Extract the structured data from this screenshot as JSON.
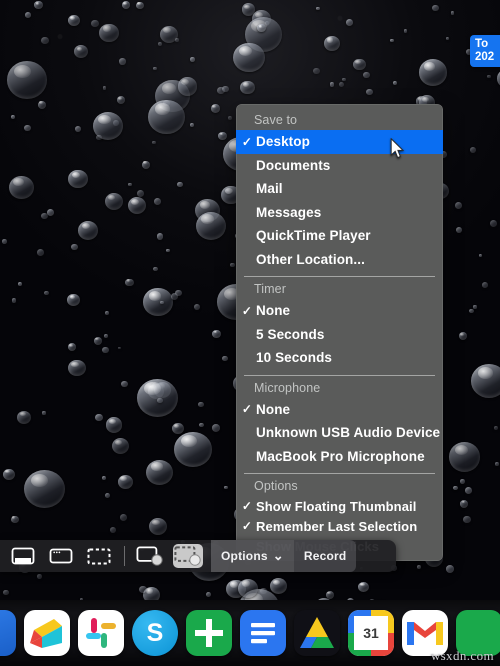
{
  "menu": {
    "sections": [
      {
        "title": "Save to",
        "items": [
          {
            "label": "Desktop",
            "checked": true,
            "highlighted": true
          },
          {
            "label": "Documents",
            "checked": false,
            "highlighted": false
          },
          {
            "label": "Mail",
            "checked": false,
            "highlighted": false
          },
          {
            "label": "Messages",
            "checked": false,
            "highlighted": false
          },
          {
            "label": "QuickTime Player",
            "checked": false,
            "highlighted": false
          },
          {
            "label": "Other Location...",
            "checked": false,
            "highlighted": false
          }
        ]
      },
      {
        "title": "Timer",
        "items": [
          {
            "label": "None",
            "checked": true,
            "highlighted": false
          },
          {
            "label": "5 Seconds",
            "checked": false,
            "highlighted": false
          },
          {
            "label": "10 Seconds",
            "checked": false,
            "highlighted": false
          }
        ]
      },
      {
        "title": "Microphone",
        "items": [
          {
            "label": "None",
            "checked": true,
            "highlighted": false
          },
          {
            "label": "Unknown USB Audio Device",
            "checked": false,
            "highlighted": false
          },
          {
            "label": "MacBook Pro Microphone",
            "checked": false,
            "highlighted": false
          }
        ]
      },
      {
        "title": "Options",
        "items": [
          {
            "label": "Show Floating Thumbnail",
            "checked": true,
            "highlighted": false
          },
          {
            "label": "Remember Last Selection",
            "checked": true,
            "highlighted": false
          },
          {
            "label": "Show Mouse Clicks",
            "checked": false,
            "highlighted": false
          }
        ]
      }
    ],
    "check_glyph": "✓",
    "highlight_color": "#0a6ef2",
    "background_color": "#5a5b5a"
  },
  "toolbar": {
    "capture_tools": [
      {
        "name": "capture-entire-screen",
        "selected": false
      },
      {
        "name": "capture-selected-window",
        "selected": false
      },
      {
        "name": "capture-selected-portion",
        "selected": false
      }
    ],
    "record_tools": [
      {
        "name": "record-entire-screen",
        "selected": false
      },
      {
        "name": "record-selected-portion",
        "selected": true
      }
    ],
    "options_label": "Options",
    "options_chevron": "⌄",
    "record_label": "Record"
  },
  "badge": {
    "line1": "To",
    "line2": "202",
    "color": "#1574f0"
  },
  "dock": {
    "items": [
      {
        "name": "dock-app-partial-left",
        "label": ""
      },
      {
        "name": "dock-app-prism",
        "label": ""
      },
      {
        "name": "dock-app-slack",
        "label": ""
      },
      {
        "name": "dock-app-skype",
        "label": "S"
      },
      {
        "name": "dock-app-sheets",
        "label": ""
      },
      {
        "name": "dock-app-docs",
        "label": ""
      },
      {
        "name": "dock-app-drive",
        "label": ""
      },
      {
        "name": "dock-app-calendar",
        "label": "31"
      },
      {
        "name": "dock-app-gmail",
        "label": ""
      },
      {
        "name": "dock-app-partial-right",
        "label": ""
      }
    ]
  },
  "watermark": {
    "text": "wsxdn.com"
  },
  "cursor": {
    "type": "arrow-pointer"
  }
}
